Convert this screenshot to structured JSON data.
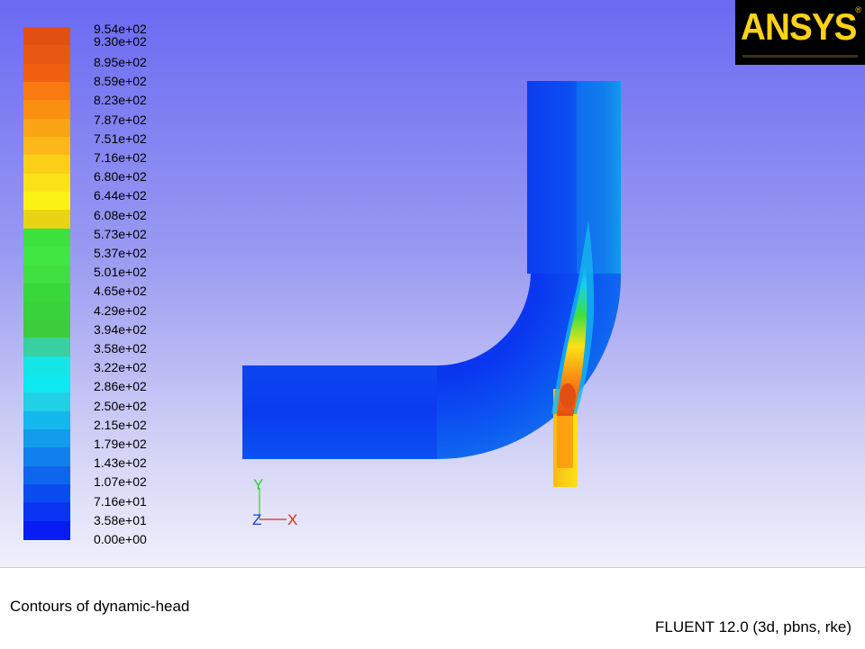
{
  "colorbar": {
    "labels": [
      "9.54e+02",
      "9.30e+02",
      "8.95e+02",
      "8.59e+02",
      "8.23e+02",
      "7.87e+02",
      "7.51e+02",
      "7.16e+02",
      "6.80e+02",
      "6.44e+02",
      "6.08e+02",
      "5.73e+02",
      "5.37e+02",
      "5.01e+02",
      "4.65e+02",
      "4.29e+02",
      "3.94e+02",
      "3.58e+02",
      "3.22e+02",
      "2.86e+02",
      "2.50e+02",
      "2.15e+02",
      "1.79e+02",
      "1.43e+02",
      "1.07e+02",
      "7.16e+01",
      "3.58e+01",
      "0.00e+00"
    ],
    "colors": [
      "#e24f12",
      "#e85812",
      "#f06010",
      "#f87a10",
      "#fb8f10",
      "#fba414",
      "#fbb818",
      "#fbcf18",
      "#fbe218",
      "#fbf214",
      "#e8d414",
      "#3ee03e",
      "#42e642",
      "#40e040",
      "#38d838",
      "#3ad23a",
      "#3ccc3c",
      "#38d0a0",
      "#14e6e6",
      "#0ee8f0",
      "#20d0e4",
      "#14b8ec",
      "#129cec",
      "#1080ee",
      "#0e66ee",
      "#0a4cf0",
      "#0a34f2",
      "#0a1cf4"
    ]
  },
  "logo": {
    "text": "ANSYS",
    "mark": "®"
  },
  "axes": {
    "y": "Y",
    "z": "Z",
    "x": "X"
  },
  "footer": {
    "title": "Contours of dynamic-head",
    "solver": "FLUENT 12.0 (3d, pbns, rke)"
  },
  "theme": {
    "pipe_base": "#0a3cf0",
    "pipe_light": "#0c5cf2",
    "jet_hot": "#e24f12",
    "jet_mid": "#fbd214",
    "jet_cool": "#3ee03e",
    "jet_cyan": "#14d0ec"
  }
}
